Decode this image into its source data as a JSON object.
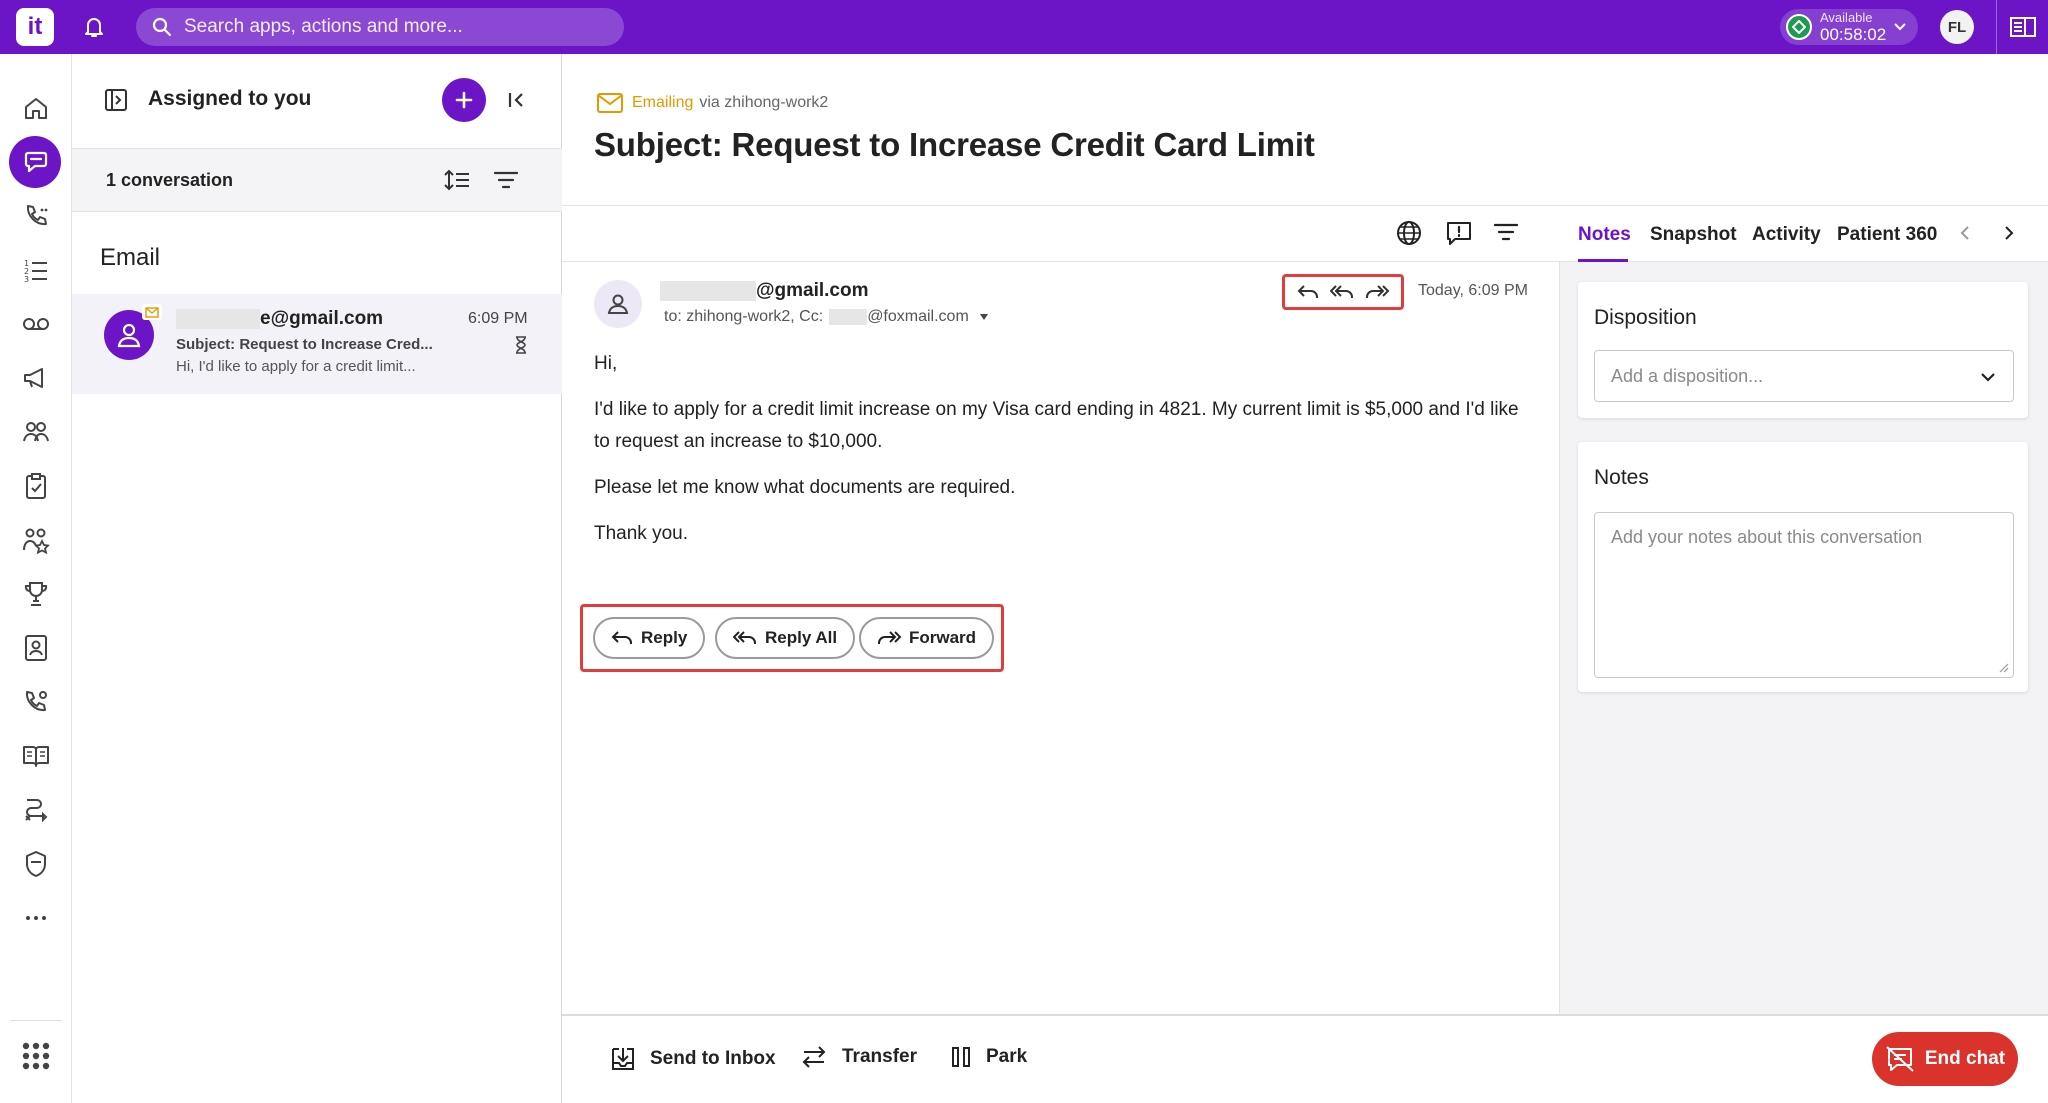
{
  "topbar": {
    "logo_text": "it",
    "search_placeholder": "Search apps, actions and more...",
    "status_label": "Available",
    "status_timer": "00:58:02",
    "user_initials": "FL"
  },
  "rail": {
    "items": [
      "home",
      "conversations",
      "calls",
      "queue",
      "voicemail",
      "campaigns",
      "contacts",
      "tasks",
      "teams",
      "trophy",
      "directory",
      "call-settings",
      "knowledge",
      "workflows",
      "security",
      "more",
      "apps"
    ]
  },
  "conv_list": {
    "title": "Assigned to you",
    "count": "1 conversation",
    "section": "Email",
    "item": {
      "from_suffix": "e@gmail.com",
      "time": "6:09 PM",
      "subject": "Subject: Request to Increase Cred...",
      "preview": "Hi, I'd like to apply for a credit limit..."
    }
  },
  "header": {
    "channel_label": "Emailing",
    "channel_via": "via zhihong-work2",
    "subject": "Subject: Request to Increase Credit Card Limit"
  },
  "email": {
    "from_suffix": "@gmail.com",
    "to_prefix": "to: zhihong-work2, Cc:",
    "cc_suffix": "@foxmail.com",
    "date": "Today, 6:09 PM",
    "body": [
      "Hi,",
      "I'd like to apply for a credit limit increase on my Visa card ending in 4821. My current limit is $5,000 and I'd like to request an increase to $10,000.",
      "Please let me know what documents are required.",
      "Thank you."
    ],
    "actions": {
      "reply": "Reply",
      "reply_all": "Reply All",
      "forward": "Forward"
    }
  },
  "right_panel": {
    "tabs": [
      "Notes",
      "Snapshot",
      "Activity",
      "Patient 360"
    ],
    "active_tab": "Notes",
    "disposition_title": "Disposition",
    "disposition_placeholder": "Add a disposition...",
    "notes_title": "Notes",
    "notes_placeholder": "Add your notes about this conversation"
  },
  "bottom_bar": {
    "send_to_inbox": "Send to Inbox",
    "transfer": "Transfer",
    "park": "Park",
    "end_chat": "End chat"
  },
  "colors": {
    "brand": "#6b15c7",
    "highlight": "#e23d3d",
    "end_chat": "#d9332b",
    "available": "#1e9b52",
    "channel": "#e29a00"
  }
}
